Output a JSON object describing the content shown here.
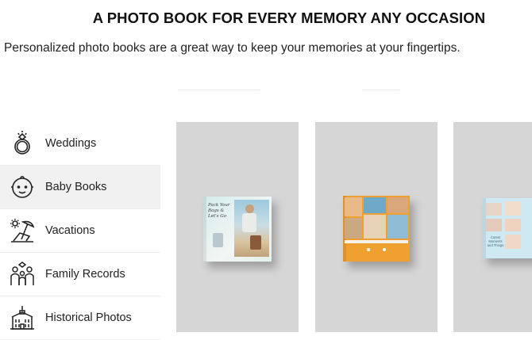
{
  "header": {
    "title": "A PHOTO BOOK FOR EVERY MEMORY ANY OCCASION",
    "subtitle": "Personalized photo books are a great way to keep your memories at your fingertips."
  },
  "sidebar": {
    "items": [
      {
        "label": "Weddings",
        "icon": "wedding-ring-icon",
        "active": false
      },
      {
        "label": "Baby Books",
        "icon": "baby-face-icon",
        "active": true
      },
      {
        "label": "Vacations",
        "icon": "beach-chair-icon",
        "active": false
      },
      {
        "label": "Family Records",
        "icon": "family-icon",
        "active": false
      },
      {
        "label": "Historical Photos",
        "icon": "historic-building-icon",
        "active": false
      }
    ]
  },
  "books": [
    {
      "cover_text": "Pack Your Bags & Let's Go"
    },
    {
      "cover_text": ""
    },
    {
      "cover_text": "Cutest Moments and Things"
    }
  ],
  "colors": {
    "card_bg": "#d6d6d6",
    "active_item_bg": "#f1f1f1",
    "book2_band": "#f0a030"
  }
}
